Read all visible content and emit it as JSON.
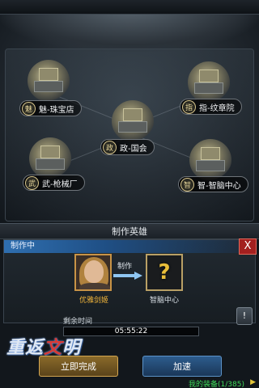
{
  "buildings": [
    {
      "id": "treasure",
      "icon": "魅",
      "label": "魅-珠宝店"
    },
    {
      "id": "badge",
      "icon": "指",
      "label": "指-纹章院"
    },
    {
      "id": "parliament",
      "icon": "政",
      "label": "政-国会"
    },
    {
      "id": "arsenal",
      "icon": "武",
      "label": "武-枪械厂"
    },
    {
      "id": "brain",
      "icon": "智",
      "label": "智-智脑中心"
    }
  ],
  "dialog": {
    "title": "制作英雄",
    "panel_title": "制作中",
    "close_label": "X",
    "hero_name": "优雅剑姬",
    "make_label": "制作",
    "target_mark": "?",
    "target_name": "智脑中心",
    "remaining_label": "剩余时间",
    "remaining_time": "05:55:22",
    "info_label": "!",
    "finish_button": "立即完成",
    "speed_button": "加速"
  },
  "logo": {
    "text_a": "重返",
    "text_b": "文",
    "text_c": "明"
  },
  "equipment": {
    "label": "我的装备(1/385)",
    "arrow": "▶"
  },
  "colors": {
    "accent_gold": "#d3a651",
    "accent_blue": "#5c93c8",
    "close_red": "#a3201f",
    "equip_green": "#3fd85a"
  }
}
